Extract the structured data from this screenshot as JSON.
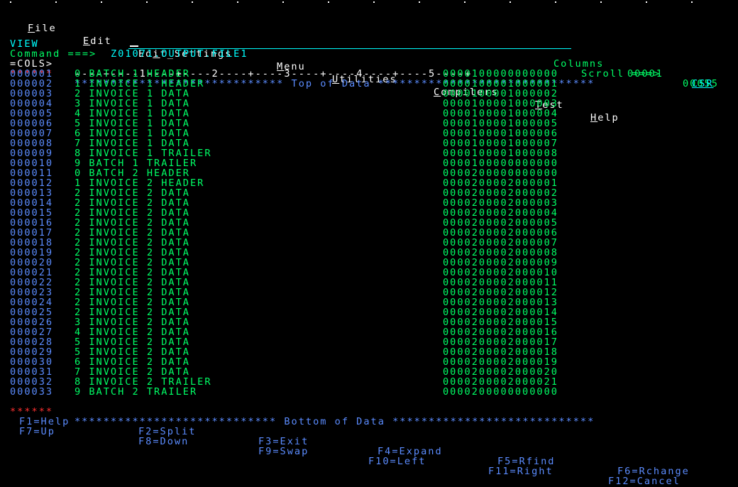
{
  "menu": {
    "items": [
      "File",
      "Edit",
      "Edit_Settings",
      "Menu",
      "Utilities",
      "Compilers",
      "Test",
      "Help"
    ],
    "mnemonics": [
      "F",
      "E",
      "i",
      "M",
      "U",
      "C",
      "T",
      "H"
    ]
  },
  "header": {
    "mode": "VIEW",
    "dataset": "Z01071.OUTPUT.FILE1",
    "columns_label": "Columns",
    "col_start": "00001",
    "col_end": "00055",
    "command_label": "Command ===>",
    "command_value": "",
    "scroll_label": "Scroll ===>",
    "scroll_value": "CSR"
  },
  "ruler": {
    "label": "=COLS>",
    "scale": "----+----1----+----2----+----3----+----4----+----5----+"
  },
  "top_marker": {
    "prefix": "******",
    "text": "***************************** Top of Data ******************************"
  },
  "bottom_marker": {
    "prefix": "******",
    "text": "**************************** Bottom of Data ****************************"
  },
  "records": [
    {
      "line": "000001",
      "text": "0 BATCH 1 HEADER",
      "num": "0000100000000000"
    },
    {
      "line": "000002",
      "text": "1 INVOICE 1 HEADER",
      "num": "0000100001000001"
    },
    {
      "line": "000003",
      "text": "2 INVOICE 1 DATA",
      "num": "0000100001000002"
    },
    {
      "line": "000004",
      "text": "3 INVOICE 1 DATA",
      "num": "0000100001000003"
    },
    {
      "line": "000005",
      "text": "4 INVOICE 1 DATA",
      "num": "0000100001000004"
    },
    {
      "line": "000006",
      "text": "5 INVOICE 1 DATA",
      "num": "0000100001000005"
    },
    {
      "line": "000007",
      "text": "6 INVOICE 1 DATA",
      "num": "0000100001000006"
    },
    {
      "line": "000008",
      "text": "7 INVOICE 1 DATA",
      "num": "0000100001000007"
    },
    {
      "line": "000009",
      "text": "8 INVOICE 1 TRAILER",
      "num": "0000100001000008"
    },
    {
      "line": "000010",
      "text": "9 BATCH 1 TRAILER",
      "num": "0000100000000000"
    },
    {
      "line": "000011",
      "text": "0 BATCH 2 HEADER",
      "num": "0000200000000000"
    },
    {
      "line": "000012",
      "text": "1 INVOICE 2 HEADER",
      "num": "0000200002000001"
    },
    {
      "line": "000013",
      "text": "2 INVOICE 2 DATA",
      "num": "0000200002000002"
    },
    {
      "line": "000014",
      "text": "2 INVOICE 2 DATA",
      "num": "0000200002000003"
    },
    {
      "line": "000015",
      "text": "2 INVOICE 2 DATA",
      "num": "0000200002000004"
    },
    {
      "line": "000016",
      "text": "2 INVOICE 2 DATA",
      "num": "0000200002000005"
    },
    {
      "line": "000017",
      "text": "2 INVOICE 2 DATA",
      "num": "0000200002000006"
    },
    {
      "line": "000018",
      "text": "2 INVOICE 2 DATA",
      "num": "0000200002000007"
    },
    {
      "line": "000019",
      "text": "2 INVOICE 2 DATA",
      "num": "0000200002000008"
    },
    {
      "line": "000020",
      "text": "2 INVOICE 2 DATA",
      "num": "0000200002000009"
    },
    {
      "line": "000021",
      "text": "2 INVOICE 2 DATA",
      "num": "0000200002000010"
    },
    {
      "line": "000022",
      "text": "2 INVOICE 2 DATA",
      "num": "0000200002000011"
    },
    {
      "line": "000023",
      "text": "2 INVOICE 2 DATA",
      "num": "0000200002000012"
    },
    {
      "line": "000024",
      "text": "2 INVOICE 2 DATA",
      "num": "0000200002000013"
    },
    {
      "line": "000025",
      "text": "2 INVOICE 2 DATA",
      "num": "0000200002000014"
    },
    {
      "line": "000026",
      "text": "3 INVOICE 2 DATA",
      "num": "0000200002000015"
    },
    {
      "line": "000027",
      "text": "4 INVOICE 2 DATA",
      "num": "0000200002000016"
    },
    {
      "line": "000028",
      "text": "5 INVOICE 2 DATA",
      "num": "0000200002000017"
    },
    {
      "line": "000029",
      "text": "5 INVOICE 2 DATA",
      "num": "0000200002000018"
    },
    {
      "line": "000030",
      "text": "6 INVOICE 2 DATA",
      "num": "0000200002000019"
    },
    {
      "line": "000031",
      "text": "7 INVOICE 2 DATA",
      "num": "0000200002000020"
    },
    {
      "line": "000032",
      "text": "8 INVOICE 2 TRAILER",
      "num": "0000200002000021"
    },
    {
      "line": "000033",
      "text": "9 BATCH 2 TRAILER",
      "num": "0000200000000000"
    }
  ],
  "pfkeys": [
    [
      "F1=Help",
      "F2=Split",
      "F3=Exit",
      "F4=Expand",
      "F5=Rfind",
      "F6=Rchange"
    ],
    [
      "F7=Up",
      "F8=Down",
      "F9=Swap",
      "F10=Left",
      "F11=Right",
      "F12=Cancel"
    ]
  ],
  "colors": {
    "background": "#000000",
    "green": "#00FF66",
    "cyan": "#00FFFF",
    "blue": "#5B8CFF",
    "red": "#FF3030",
    "white": "#FFFFFF"
  }
}
